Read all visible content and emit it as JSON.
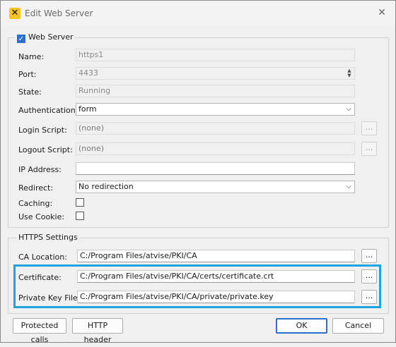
{
  "window": {
    "title": "Edit Web Server",
    "close_symbol": "✕"
  },
  "web_server": {
    "group_label": "Web Server",
    "enabled": true,
    "name_label": "Name:",
    "name_value": "https1",
    "port_label": "Port:",
    "port_value": "4433",
    "state_label": "State:",
    "state_value": "Running",
    "auth_label": "Authentication:",
    "auth_value": "form",
    "login_label": "Login Script:",
    "login_value": "(none)",
    "logout_label": "Logout Script:",
    "logout_value": "(none)",
    "ip_label": "IP Address:",
    "ip_value": "",
    "redirect_label": "Redirect:",
    "redirect_value": "No redirection",
    "caching_label": "Caching:",
    "caching_checked": false,
    "cookie_label": "Use Cookie:",
    "cookie_checked": false
  },
  "https": {
    "group_label": "HTTPS Settings",
    "ca_label": "CA Location:",
    "ca_value": "C:/Program Files/atvise/PKI/CA",
    "cert_label": "Certificate:",
    "cert_value": "C:/Program Files/atvise/PKI/CA/certs/certificate.crt",
    "key_label": "Private Key File:",
    "key_value": "C:/Program Files/atvise/PKI/CA/private/private.key"
  },
  "browse_label": "...",
  "buttons": {
    "protected_calls": "Protected calls",
    "http_header": "HTTP header",
    "ok": "OK",
    "cancel": "Cancel"
  },
  "colors": {
    "accent": "#2f6fcc",
    "highlight": "#1ca3e0"
  }
}
